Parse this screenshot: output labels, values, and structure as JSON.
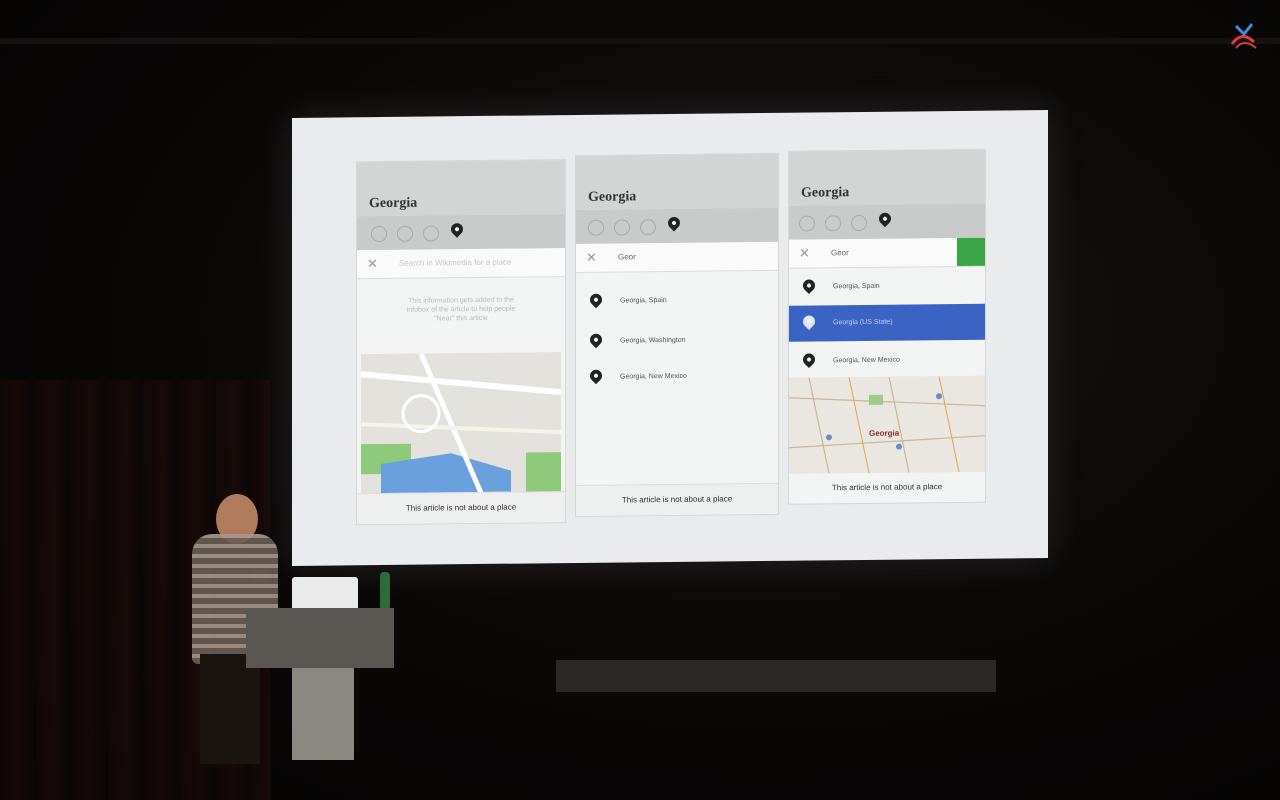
{
  "slide": {
    "panels": [
      {
        "title": "Georgia",
        "search_text": "Search in Wikimedia for a place",
        "hint": "This information gets added to the infobox of the article to help people \"Near\" this article",
        "footer": "This article is not about a place"
      },
      {
        "title": "Georgia",
        "search_text": "Geor",
        "results": [
          "Georgia, Spain",
          "Georgia, Washington",
          "Georgia, New Mexico"
        ],
        "footer": "This article is not about a place"
      },
      {
        "title": "Georgia",
        "search_text": "Geor",
        "results": [
          "Georgia, Spain",
          "Georgia (US State)",
          "Georgia, New Mexico"
        ],
        "map_label": "Georgia",
        "footer": "This article is not about a place"
      }
    ]
  },
  "colors": {
    "selected": "#3a63c3",
    "confirm": "#3aa547"
  },
  "icons": [
    "pin-icon",
    "close-icon",
    "conference-logo-icon"
  ]
}
